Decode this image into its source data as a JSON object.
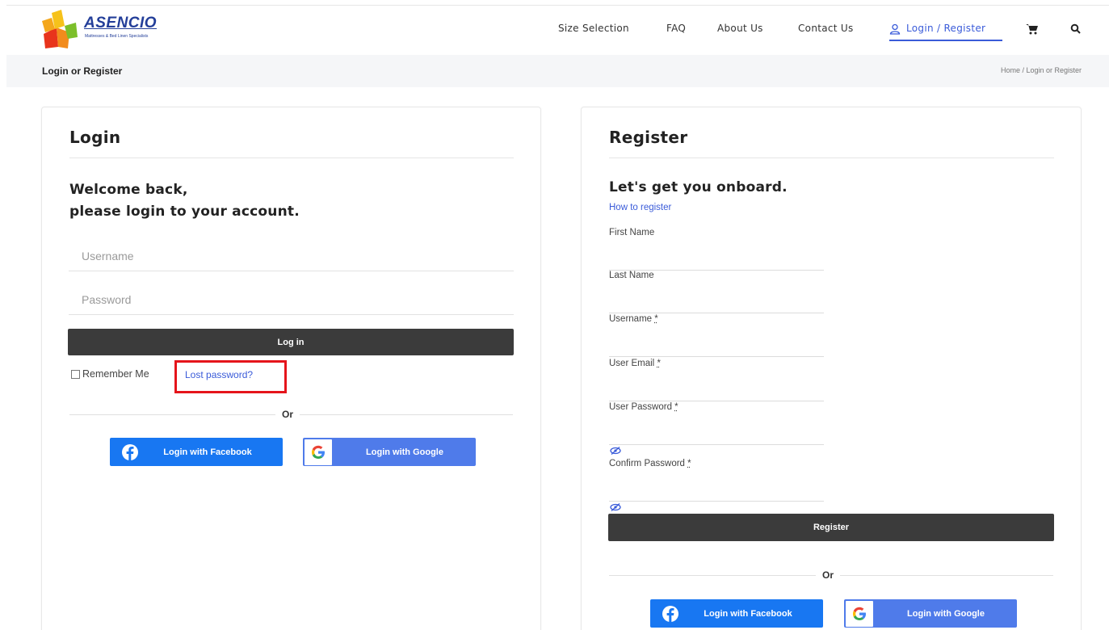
{
  "header": {
    "logo_text": "ASENCIO",
    "logo_tagline": "Mattresses & Bed Linen Specialists",
    "nav": [
      {
        "label": "Size Selection"
      },
      {
        "label": "FAQ"
      },
      {
        "label": "About Us"
      },
      {
        "label": "Contact Us"
      },
      {
        "label": "Login / Register",
        "active": true
      }
    ],
    "icons": [
      "user-icon",
      "cart-icon",
      "search-icon"
    ]
  },
  "breadcrumb": {
    "title": "Login or Register",
    "path": "Home / Login or Register"
  },
  "login": {
    "title": "Login",
    "welcome_line1": "Welcome back,",
    "welcome_line2": "please login to your account.",
    "username_placeholder": "Username",
    "password_placeholder": "Password",
    "login_button": "Log in",
    "remember_label": "Remember Me",
    "lost_password": "Lost password?",
    "or": "Or",
    "facebook_button": "Login with Facebook",
    "google_button": "Login with Google"
  },
  "register": {
    "title": "Register",
    "subtitle": "Let's get you onboard.",
    "how_link": "How to register",
    "fields": [
      {
        "label": "First Name",
        "required": false
      },
      {
        "label": "Last Name",
        "required": false
      },
      {
        "label": "Username",
        "required": true
      },
      {
        "label": "User Email",
        "required": true
      },
      {
        "label": "User Password",
        "required": true
      },
      {
        "label": "Confirm Password",
        "required": true
      }
    ],
    "required_mark": "*",
    "register_button": "Register",
    "or": "Or",
    "facebook_button": "Login with Facebook",
    "google_button": "Login with Google"
  },
  "colors": {
    "accent": "#3a5bd9",
    "dark_button": "#3b3b3b",
    "facebook": "#1877f2",
    "google": "#4f7bea",
    "highlight": "#e5141b"
  }
}
